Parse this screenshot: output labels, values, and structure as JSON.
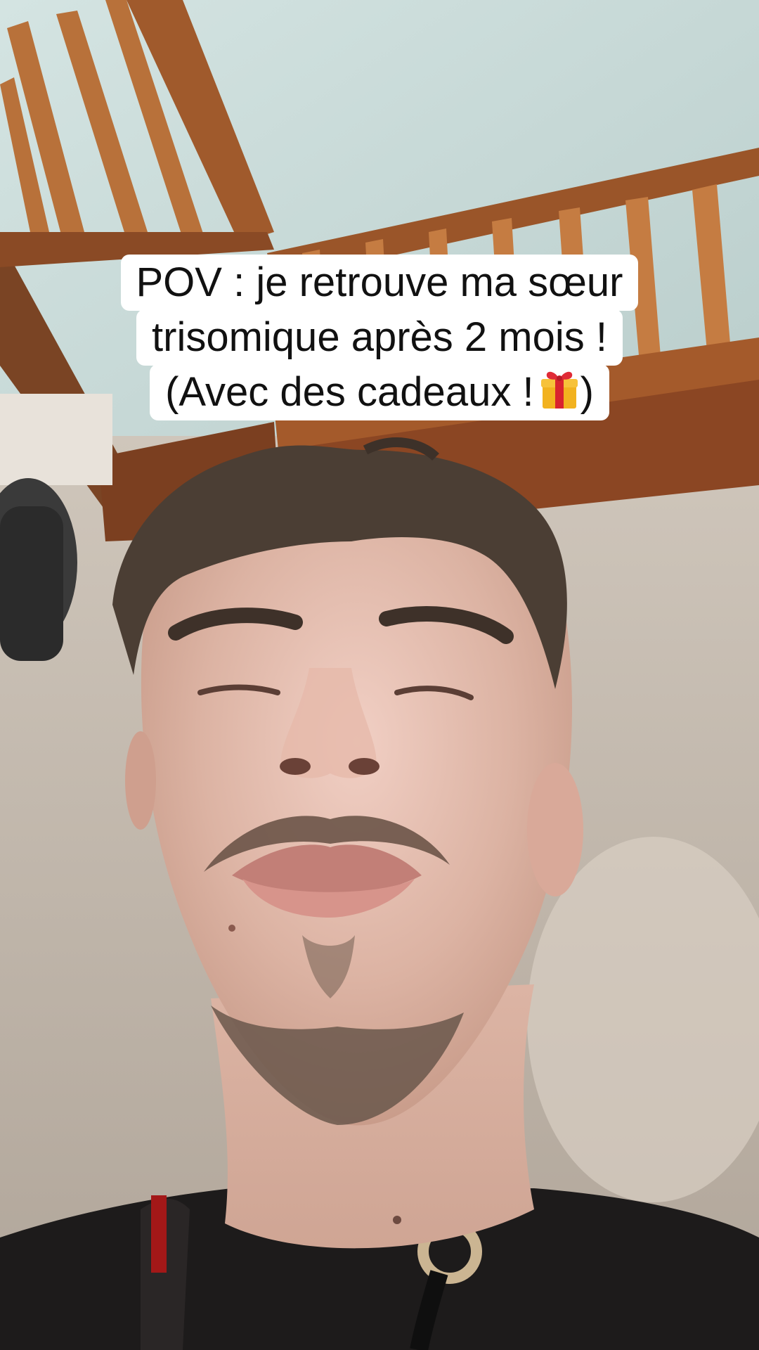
{
  "caption": {
    "line1": "POV : je retrouve ma sœur",
    "line2": "trisomique après 2 mois !",
    "line3_text": "(Avec des cadeaux !",
    "line3_emoji": "gift-emoji",
    "line3_close": ")"
  },
  "colors": {
    "caption_bg": "#ffffff",
    "caption_text": "#111111",
    "ceiling": "#c9dbda",
    "railing": "#b0672e",
    "wall": "#c4b8aa",
    "skin": "#e2bcae",
    "hair": "#4d4036",
    "hoodie": "#1c1a1a"
  }
}
